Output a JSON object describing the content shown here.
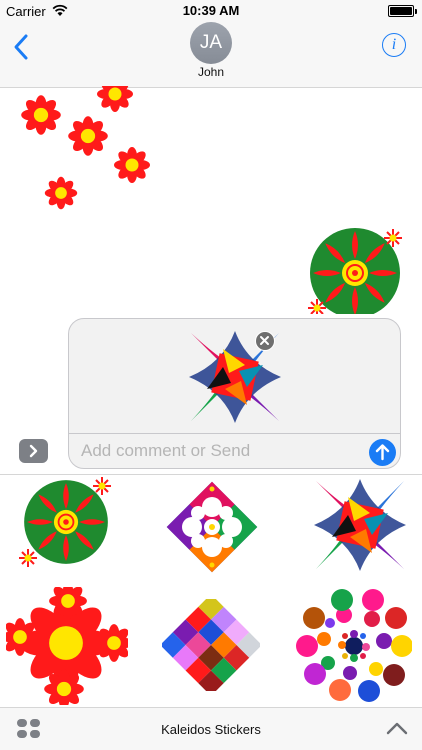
{
  "status_bar": {
    "carrier": "Carrier",
    "time": "10:39 AM"
  },
  "nav": {
    "avatar_initials": "JA",
    "contact_name": "John",
    "info_glyph": "i"
  },
  "compose": {
    "placeholder": "Add comment or Send"
  },
  "bottom_bar": {
    "title": "Kaleidos Stickers"
  },
  "colors": {
    "accent": "#1a7cf5",
    "red": "#ff0000",
    "green": "#1f8a2f",
    "yellow": "#ffe600"
  },
  "icons": [
    "back-chevron-icon",
    "info-icon",
    "wifi-icon",
    "battery-icon",
    "remove-icon",
    "send-arrow-icon",
    "expand-chevron-icon",
    "app-grid-icon",
    "chevron-up-icon"
  ],
  "stickers": [
    "red-flowers",
    "green-mandala",
    "pinwheel-star",
    "diamond-mosaic",
    "colorful-star",
    "red-flower-cluster",
    "color-squares",
    "dot-ring"
  ]
}
